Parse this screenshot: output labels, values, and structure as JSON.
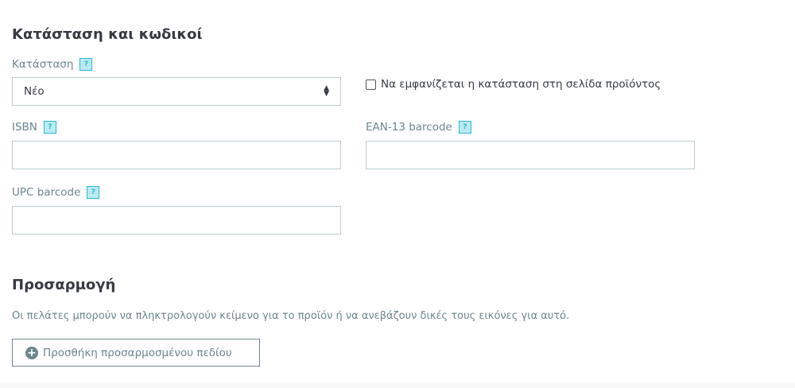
{
  "section1": {
    "title": "Κατάσταση και κωδικοί",
    "condition": {
      "label": "Κατάσταση",
      "help": "?",
      "value": "Νέο"
    },
    "show_condition": {
      "label": "Να εμφανίζεται η κατάσταση στη σελίδα προϊόντος",
      "checked": false
    },
    "isbn": {
      "label": "ISBN",
      "help": "?",
      "value": ""
    },
    "ean13": {
      "label": "EAN-13 barcode",
      "help": "?",
      "value": ""
    },
    "upc": {
      "label": "UPC barcode",
      "help": "?",
      "value": ""
    }
  },
  "section2": {
    "title": "Προσαρμογή",
    "description": "Οι πελάτες μπορούν να πληκτρολογούν κείμενο για το προϊόν ή να ανεβάζουν δικές τους εικόνες για αυτό.",
    "add_button": "Προσθήκη προσαρμοσμένου πεδίου"
  }
}
